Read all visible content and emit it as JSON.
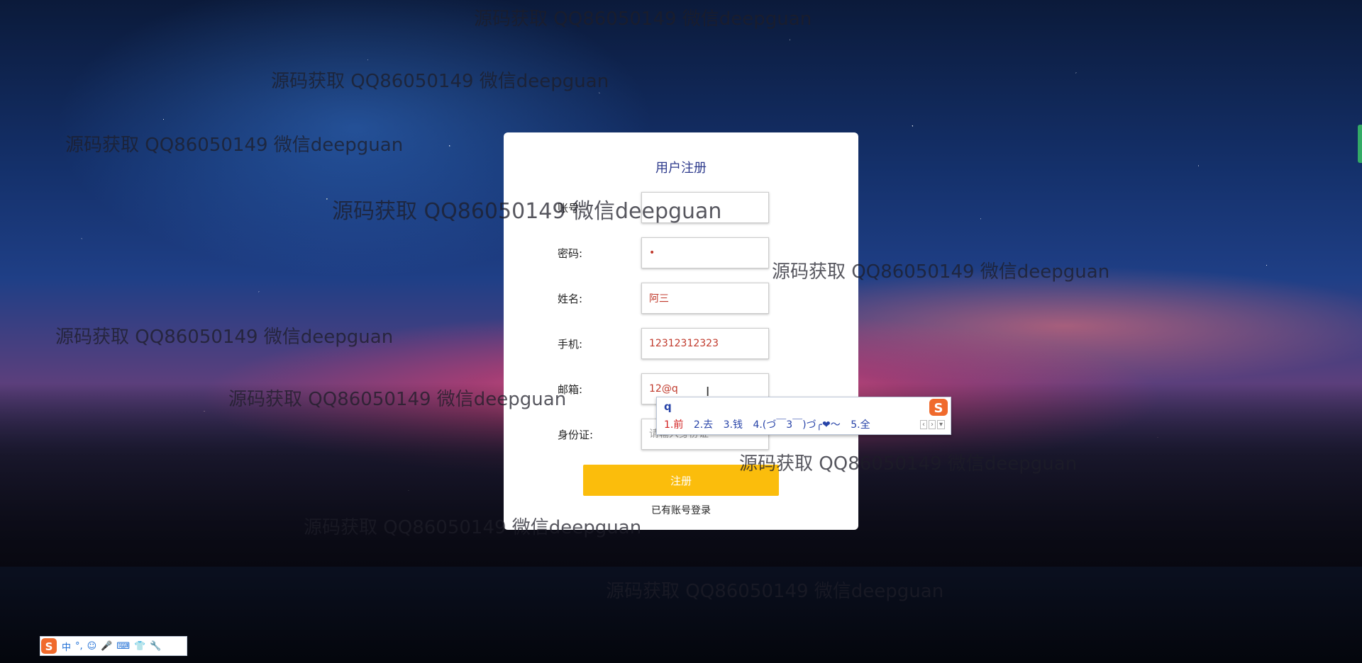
{
  "form": {
    "title": "用户注册",
    "fields": [
      {
        "label": "账号:",
        "value": "",
        "placeholder": ""
      },
      {
        "label": "密码:",
        "value": "•",
        "placeholder": ""
      },
      {
        "label": "姓名:",
        "value": "阿三",
        "placeholder": ""
      },
      {
        "label": "手机:",
        "value": "12312312323",
        "placeholder": ""
      },
      {
        "label": "邮箱:",
        "value": "12@q",
        "placeholder": ""
      },
      {
        "label": "身份证:",
        "value": "",
        "placeholder": "请输入身份证"
      }
    ],
    "submit_label": "注册",
    "login_link": "已有账号登录"
  },
  "ime": {
    "input": "q",
    "candidates": [
      "1.前",
      "2.去",
      "3.钱",
      "4.(づ￣3￣)づ╭❤～",
      "5.全"
    ]
  },
  "taskbar": {
    "items": [
      "中",
      "°,",
      "☺",
      "🎤",
      "⌨",
      "👕",
      "🔧"
    ]
  },
  "watermark": {
    "text": "源码获取 QQ86050149 微信deepguan"
  },
  "colors": {
    "accent": "#fbbd0c",
    "title": "#2d3a8c",
    "input_text": "#c0392b"
  }
}
